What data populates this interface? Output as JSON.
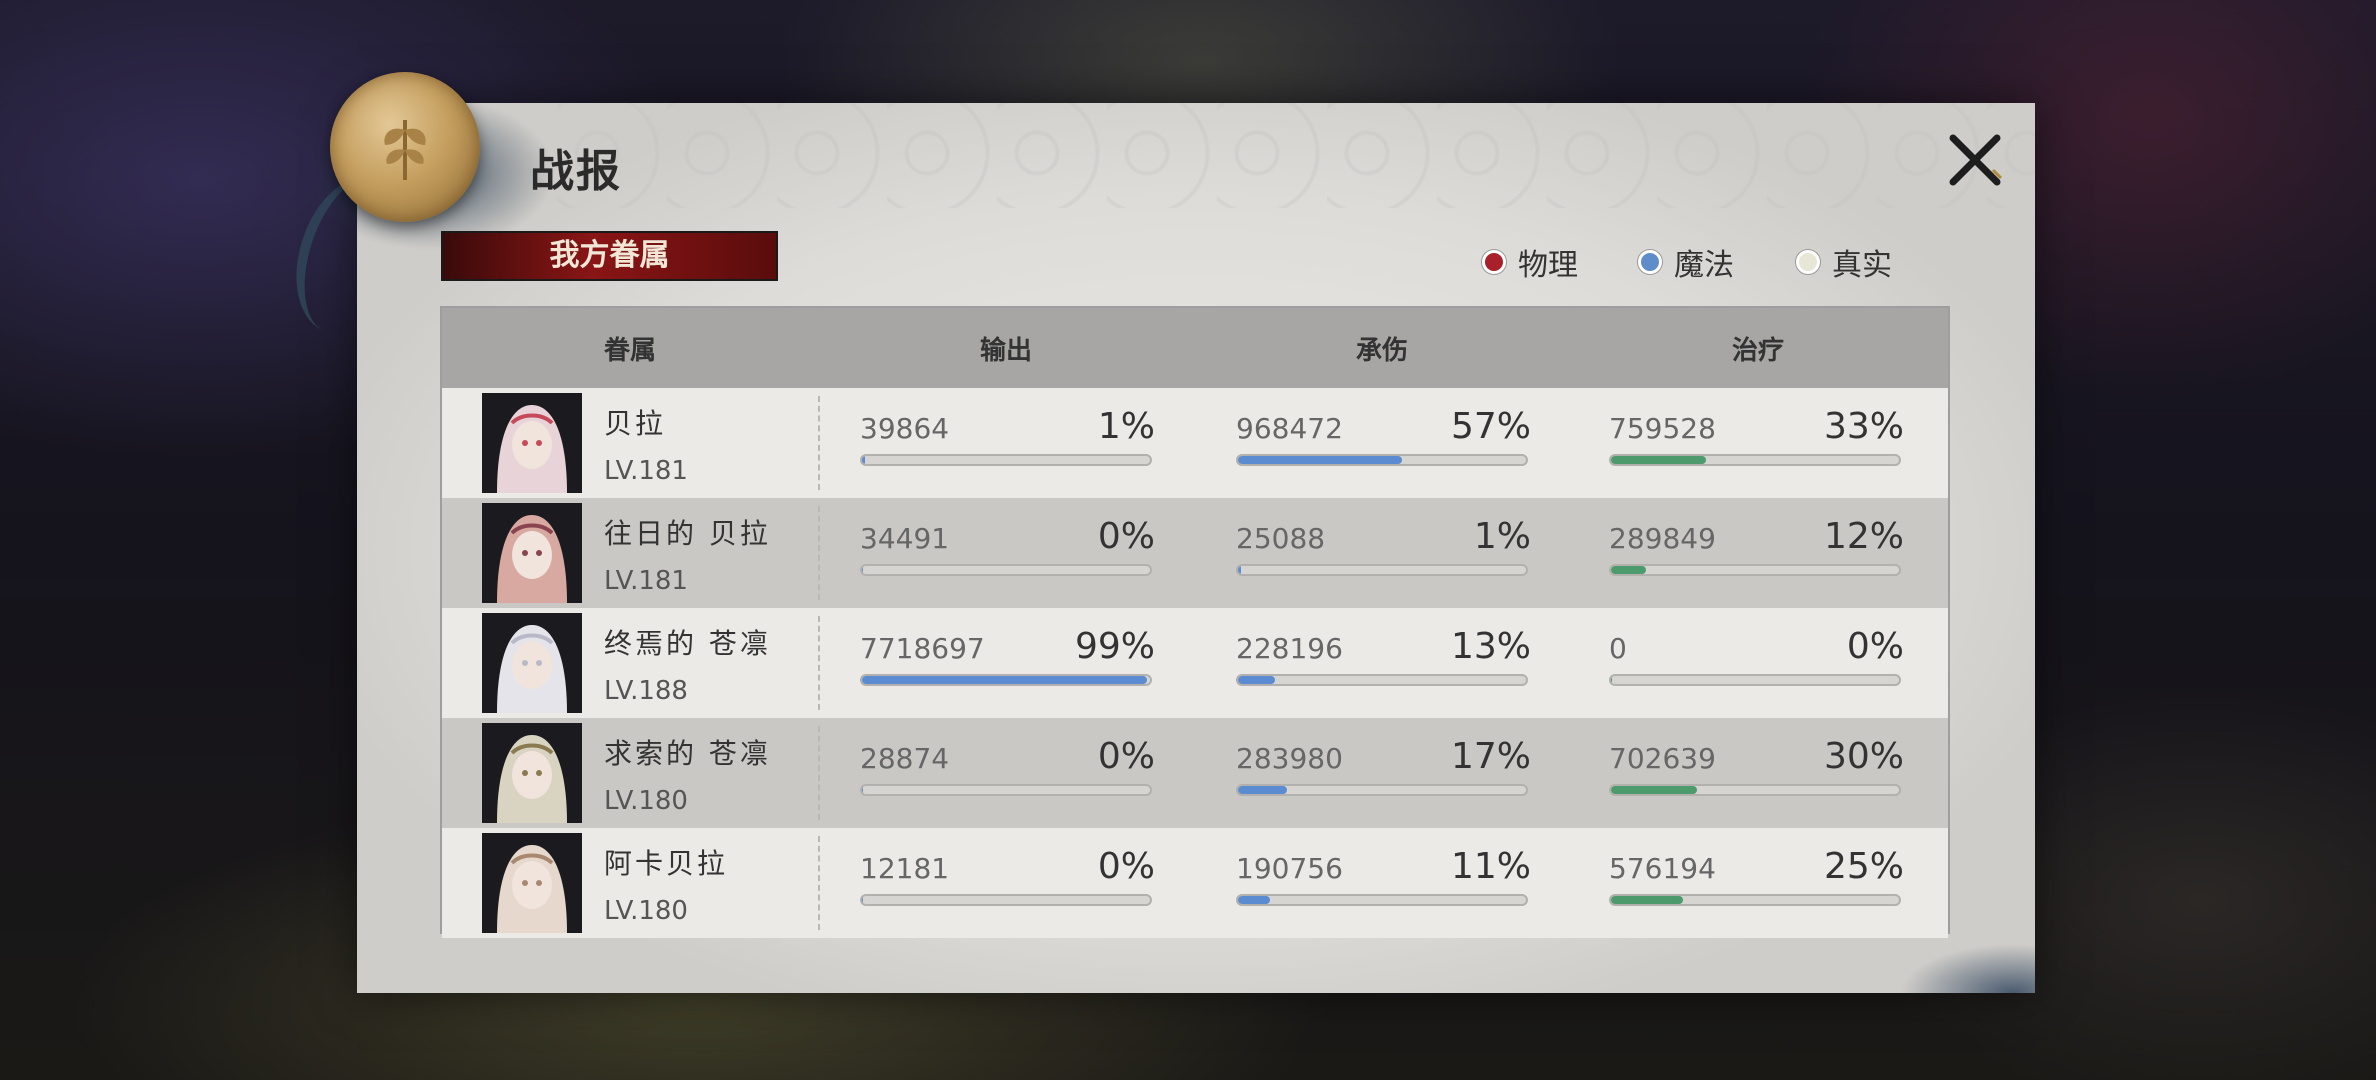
{
  "title": "战报",
  "tab": "我方眷属",
  "legend": [
    {
      "label": "物理",
      "color": "#a8202a"
    },
    {
      "label": "魔法",
      "color": "#5f8dc9"
    },
    {
      "label": "真实",
      "color": "#e8e6d6"
    }
  ],
  "columns": [
    "眷属",
    "输出",
    "承伤",
    "治疗"
  ],
  "bar_colors": {
    "output": "#5b8bd0",
    "taken": "#5b8bd0",
    "heal": "#4d9a6c"
  },
  "rows": [
    {
      "name": "贝拉",
      "level": "LV.181",
      "output": {
        "value": "39864",
        "pct": "1%"
      },
      "taken": {
        "value": "968472",
        "pct": "57%"
      },
      "heal": {
        "value": "759528",
        "pct": "33%"
      }
    },
    {
      "name": "往日的 贝拉",
      "level": "LV.181",
      "output": {
        "value": "34491",
        "pct": "0%"
      },
      "taken": {
        "value": "25088",
        "pct": "1%"
      },
      "heal": {
        "value": "289849",
        "pct": "12%"
      }
    },
    {
      "name": "终焉的 苍凛",
      "level": "LV.188",
      "output": {
        "value": "7718697",
        "pct": "99%"
      },
      "taken": {
        "value": "228196",
        "pct": "13%"
      },
      "heal": {
        "value": "0",
        "pct": "0%"
      }
    },
    {
      "name": "求索的 苍凛",
      "level": "LV.180",
      "output": {
        "value": "28874",
        "pct": "0%"
      },
      "taken": {
        "value": "283980",
        "pct": "17%"
      },
      "heal": {
        "value": "702639",
        "pct": "30%"
      }
    },
    {
      "name": "阿卡贝拉",
      "level": "LV.180",
      "output": {
        "value": "12181",
        "pct": "0%"
      },
      "taken": {
        "value": "190756",
        "pct": "11%"
      },
      "heal": {
        "value": "576194",
        "pct": "25%"
      }
    }
  ]
}
